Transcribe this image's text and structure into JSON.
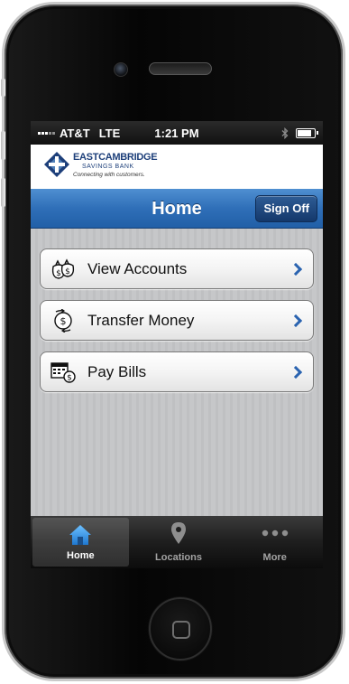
{
  "status_bar": {
    "carrier": "AT&T",
    "network": "LTE",
    "time": "1:21 PM",
    "bluetooth_icon": "bluetooth-icon",
    "battery_icon": "battery-icon"
  },
  "brand": {
    "line1": "EASTCAMBRIDGE",
    "line2": "SAVINGS BANK",
    "tagline": "Connecting with customers."
  },
  "nav": {
    "title": "Home",
    "sign_off": "Sign Off"
  },
  "menu": [
    {
      "label": "View Accounts",
      "icon": "money-bags-icon"
    },
    {
      "label": "Transfer Money",
      "icon": "transfer-icon"
    },
    {
      "label": "Pay Bills",
      "icon": "calendar-dollar-icon"
    }
  ],
  "tabs": [
    {
      "label": "Home",
      "icon": "house-icon",
      "active": true
    },
    {
      "label": "Locations",
      "icon": "location-pin-icon",
      "active": false
    },
    {
      "label": "More",
      "icon": "more-dots-icon",
      "active": false
    }
  ],
  "colors": {
    "nav_blue": "#2f6fb8",
    "brand_navy": "#1d3f7a",
    "accent_icon": "#2d8ee0",
    "chevron": "#2a63b0"
  }
}
